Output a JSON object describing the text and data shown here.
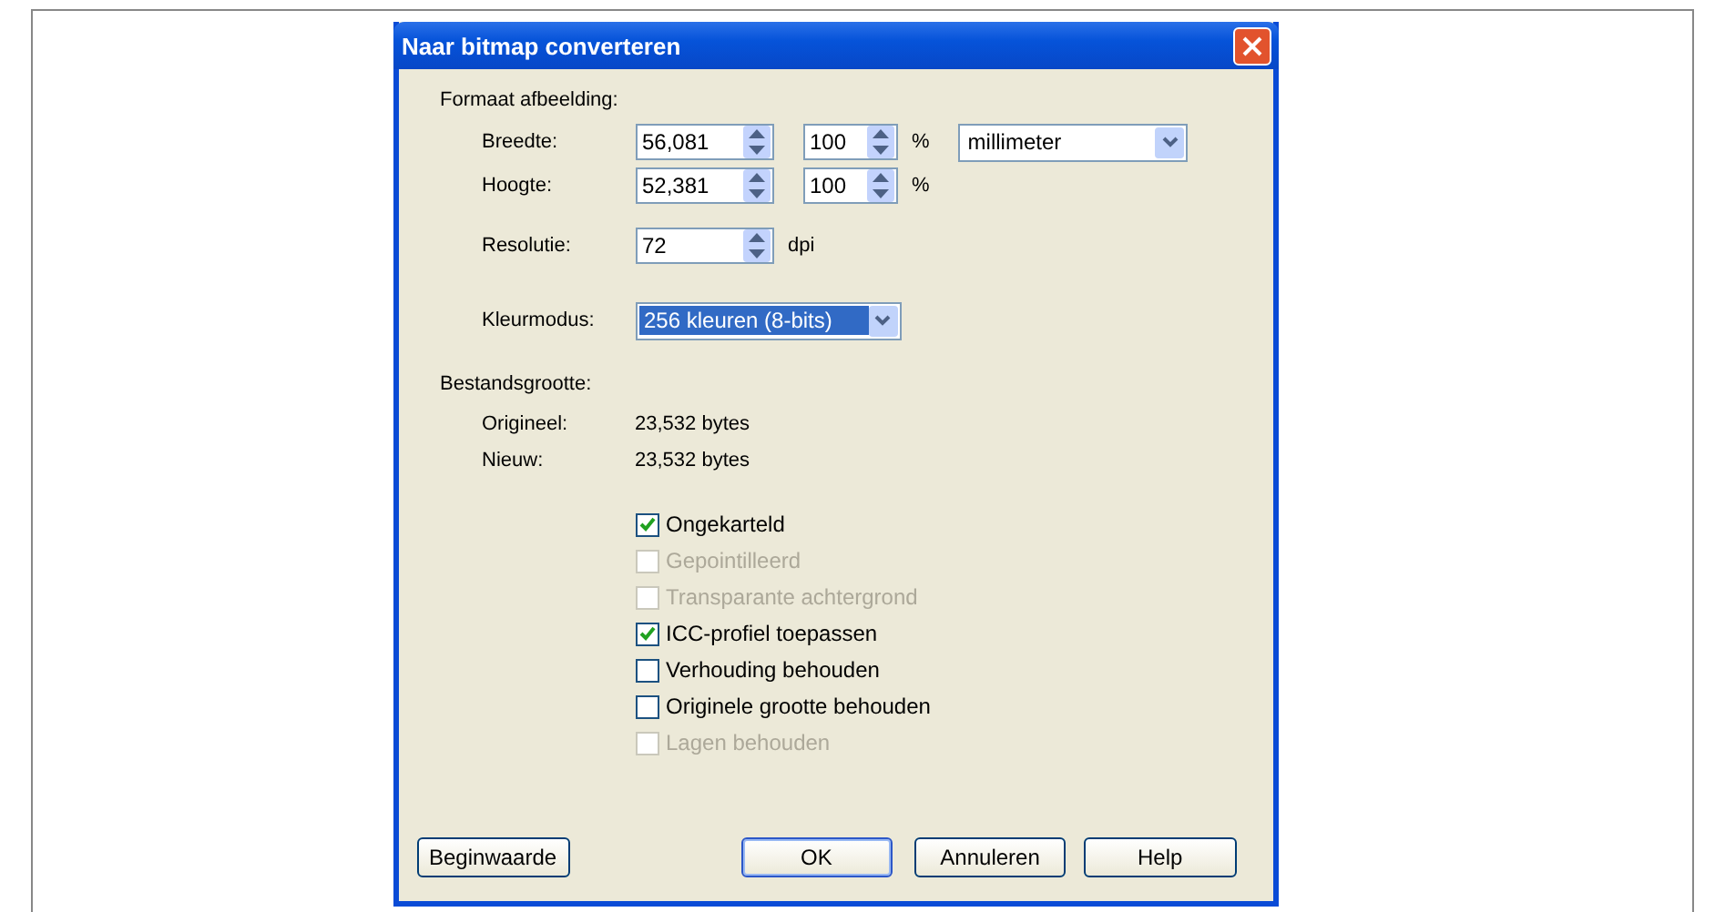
{
  "window": {
    "title": "Naar bitmap converteren"
  },
  "image_size": {
    "heading": "Formaat afbeelding:",
    "rows": [
      {
        "label": "Breedte:",
        "value": "56,081",
        "percent": "100",
        "percent_unit": "%",
        "unit": "millimeter"
      },
      {
        "label": "Hoogte:",
        "value": "52,381",
        "percent": "100",
        "percent_unit": "%"
      }
    ],
    "resolution": {
      "label": "Resolutie:",
      "value": "72",
      "unit": "dpi"
    },
    "color_mode": {
      "label": "Kleurmodus:",
      "value": "256 kleuren (8-bits)"
    }
  },
  "file_size": {
    "heading": "Bestandsgrootte:",
    "rows": [
      {
        "label": "Origineel:",
        "value": "23,532 bytes"
      },
      {
        "label": "Nieuw:",
        "value": "23,532 bytes"
      }
    ]
  },
  "options": [
    {
      "label": "Ongekarteld",
      "checked": true,
      "disabled": false
    },
    {
      "label": "Gepointilleerd",
      "checked": false,
      "disabled": true
    },
    {
      "label": "Transparante achtergrond",
      "checked": false,
      "disabled": true
    },
    {
      "label": "ICC-profiel toepassen",
      "checked": true,
      "disabled": false
    },
    {
      "label": "Verhouding behouden",
      "checked": false,
      "disabled": false
    },
    {
      "label": "Originele grootte behouden",
      "checked": false,
      "disabled": false
    },
    {
      "label": "Lagen behouden",
      "checked": false,
      "disabled": true
    }
  ],
  "buttons": [
    {
      "label": "Beginwaarde",
      "default": false
    },
    {
      "label": "OK",
      "default": true
    },
    {
      "label": "Annuleren",
      "default": false
    },
    {
      "label": "Help",
      "default": false
    }
  ]
}
